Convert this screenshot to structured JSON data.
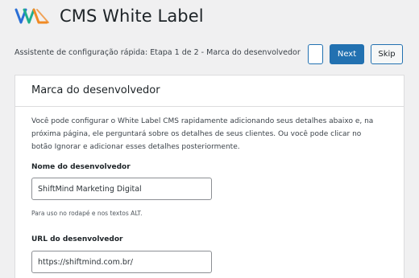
{
  "app": {
    "title": "CMS White Label"
  },
  "wizard": {
    "step_text": "Assistente de configuração rápida: Etapa 1 de 2 - Marca do desenvolvedor",
    "next_label": "Next",
    "skip_label": "Skip"
  },
  "panel": {
    "title": "Marca do desenvolvedor",
    "description": "Você pode configurar o White Label CMS rapidamente adicionando seus detalhes abaixo e, na próxima página, ele perguntará sobre os detalhes de seus clientes. Ou você pode clicar no botão Ignorar e adicionar esses detalhes posteriormente.",
    "fields": {
      "developer_name": {
        "label": "Nome do desenvolvedor",
        "value": "ShiftMind Marketing Digital",
        "help": "Para uso no rodapé e nos textos ALT."
      },
      "developer_url": {
        "label": "URL do desenvolvedor",
        "value": "https://shiftmind.com.br/"
      }
    }
  },
  "colors": {
    "page_background": "#f0f0f1",
    "primary": "#2271b1",
    "border": "#dcdcde",
    "logo_left": "#2a6fd6",
    "logo_middle": "#1faf8c",
    "logo_right": "#f08a24"
  },
  "icons": {
    "logo": "white-label-logo-icon"
  }
}
